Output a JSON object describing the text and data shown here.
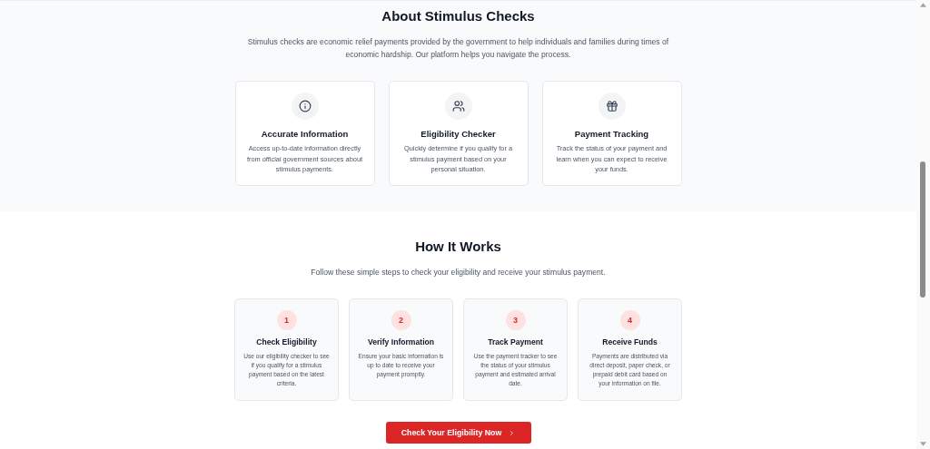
{
  "about": {
    "title": "About Stimulus Checks",
    "description": "Stimulus checks are economic relief payments provided by the government to help individuals and families during times of economic hardship. Our platform helps you navigate the process.",
    "features": [
      {
        "title": "Accurate Information",
        "description": "Access up-to-date information directly from official government sources about stimulus payments."
      },
      {
        "title": "Eligibility Checker",
        "description": "Quickly determine if you qualify for a stimulus payment based on your personal situation."
      },
      {
        "title": "Payment Tracking",
        "description": "Track the status of your payment and learn when you can expect to receive your funds."
      }
    ]
  },
  "how_it_works": {
    "title": "How It Works",
    "description": "Follow these simple steps to check your eligibility and receive your stimulus payment.",
    "steps": [
      {
        "number": "1",
        "title": "Check Eligibility",
        "description": "Use our eligibility checker to see if you qualify for a stimulus payment based on the latest criteria."
      },
      {
        "number": "2",
        "title": "Verify Information",
        "description": "Ensure your basic information is up to date to receive your payment promptly."
      },
      {
        "number": "3",
        "title": "Track Payment",
        "description": "Use the payment tracker to see the status of your stimulus payment and estimated arrival date."
      },
      {
        "number": "4",
        "title": "Receive Funds",
        "description": "Payments are distributed via direct deposit, paper check, or prepaid debit card based on your information on file."
      }
    ],
    "cta": "Check Your Eligibility Now"
  }
}
